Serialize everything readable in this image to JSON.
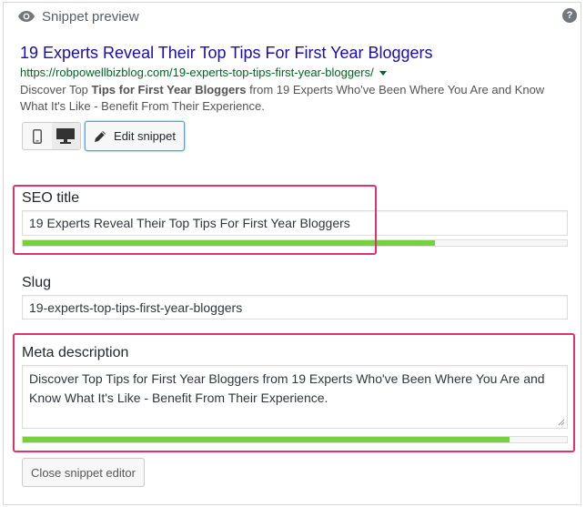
{
  "header": {
    "title": "Snippet preview",
    "eye_icon": "eye-icon",
    "help_icon": "?"
  },
  "preview": {
    "title": "19 Experts Reveal Their Top Tips For First Year Bloggers",
    "url": "https://robpowellbizblog.com/19-experts-top-tips-first-year-bloggers/",
    "description_before": "Discover Top ",
    "description_bold": "Tips for First Year Bloggers",
    "description_after": " from 19 Experts Who've Been Where You Are and Know What It's Like - Benefit From Their Experience."
  },
  "modes": {
    "mobile_icon": "mobile-icon",
    "desktop_icon": "desktop-icon",
    "active": "desktop"
  },
  "edit_button": {
    "label": "Edit snippet"
  },
  "seo_title": {
    "label": "SEO title",
    "value": "19 Experts Reveal Their Top Tips For First Year Bloggers",
    "progress": 0.758
  },
  "slug": {
    "label": "Slug",
    "value": "19-experts-top-tips-first-year-bloggers"
  },
  "meta_description": {
    "label": "Meta description",
    "value": "Discover Top Tips for First Year Bloggers from 19 Experts Who've Been Where You Are and Know What It's Like - Benefit From Their Experience.",
    "progress": 0.895
  },
  "close_button": {
    "label": "Close snippet editor"
  },
  "colors": {
    "link": "#1a0dab",
    "url": "#006621",
    "progress_good": "#7ad03a",
    "highlight": "#e0336e"
  }
}
